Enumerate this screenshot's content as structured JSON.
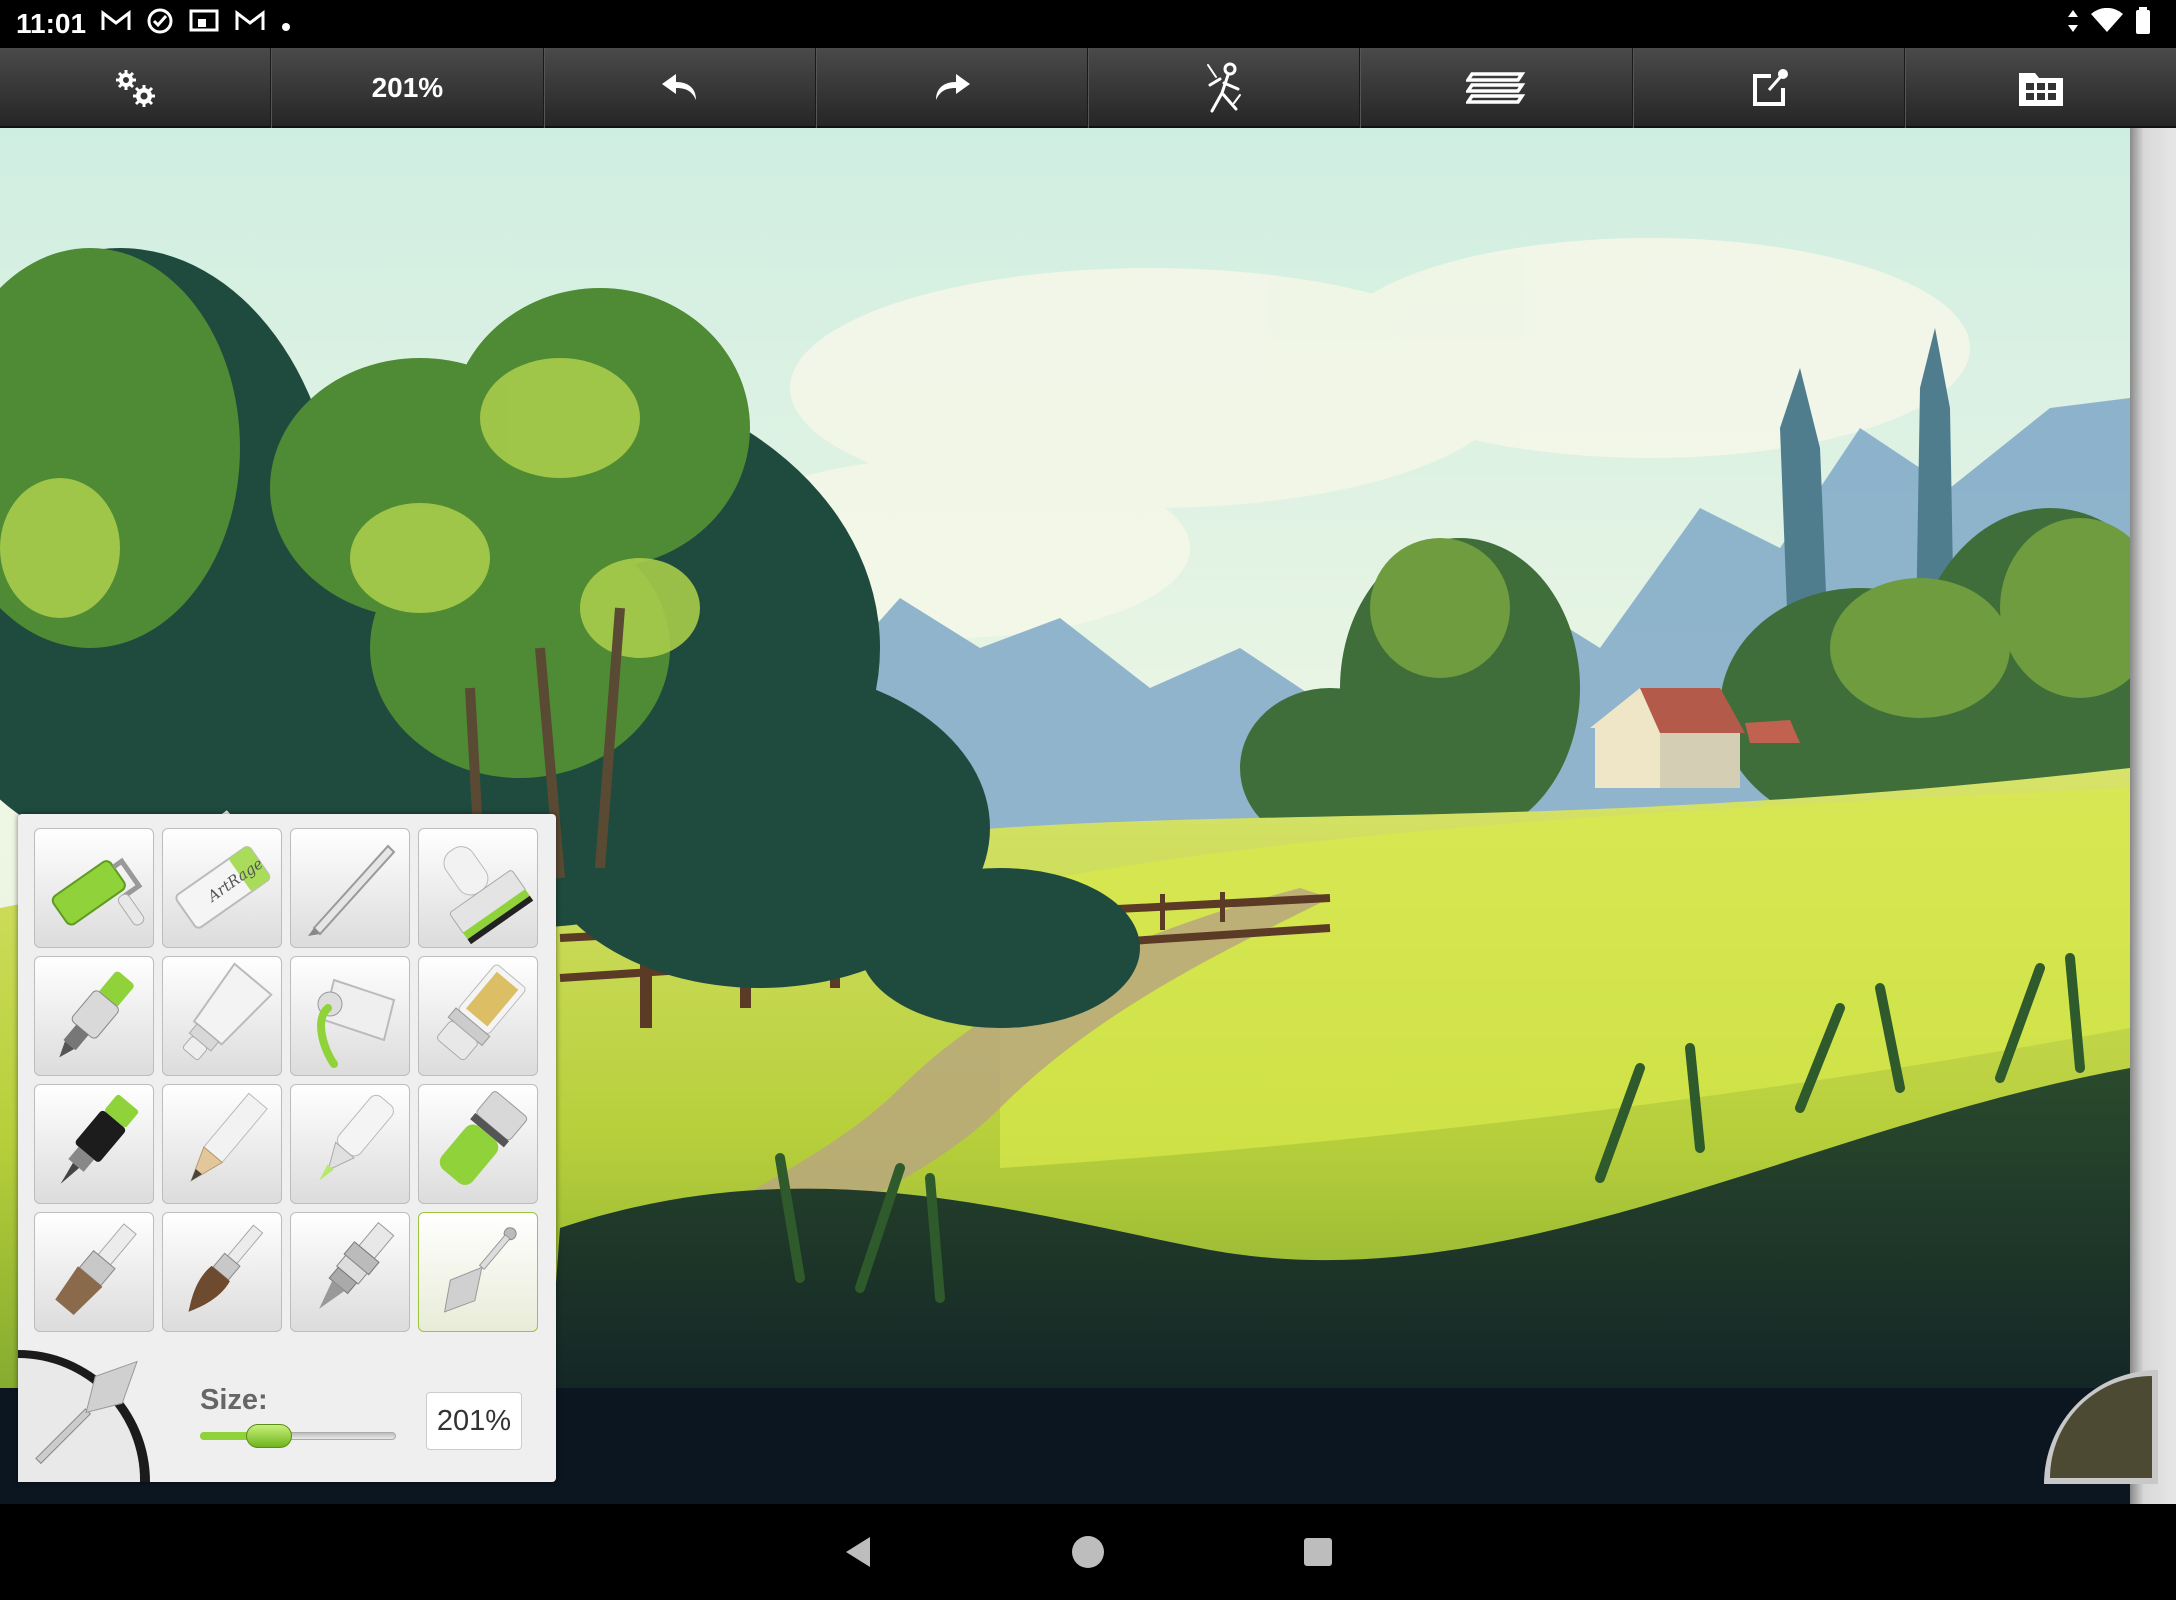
{
  "status_bar": {
    "time": "11:01",
    "left_icons": [
      "gmail-icon",
      "task-check-icon",
      "cast-icon",
      "gmail-icon",
      "dot-icon"
    ],
    "right_icons": [
      "data-arrows-icon",
      "wifi-icon",
      "battery-icon"
    ]
  },
  "toolbar": {
    "zoom": "201%",
    "buttons": [
      "settings",
      "zoom",
      "undo",
      "redo",
      "tracing",
      "layers",
      "share",
      "gallery"
    ]
  },
  "tool_panel": {
    "tools": [
      "paint-roller",
      "eraser",
      "palette-knife-pencil",
      "glitter-stamp",
      "airbrush",
      "paint-tube",
      "ink-pen-tube",
      "glitter-tube",
      "inking-pen",
      "pencil",
      "felt-pen",
      "chalk",
      "flat-brush",
      "round-brush",
      "airbrush-nozzle",
      "palette-knife"
    ],
    "eraser_brand": "ArtRage",
    "selected_tool": "palette-knife",
    "size_label": "Size:",
    "size_value": "201%",
    "size_fraction": 0.35,
    "accent_color": "#8fd23a"
  },
  "color_picker": {
    "current_color": "#4d4a33"
  },
  "nav_bar": {
    "buttons": [
      "back",
      "home",
      "recents"
    ]
  }
}
